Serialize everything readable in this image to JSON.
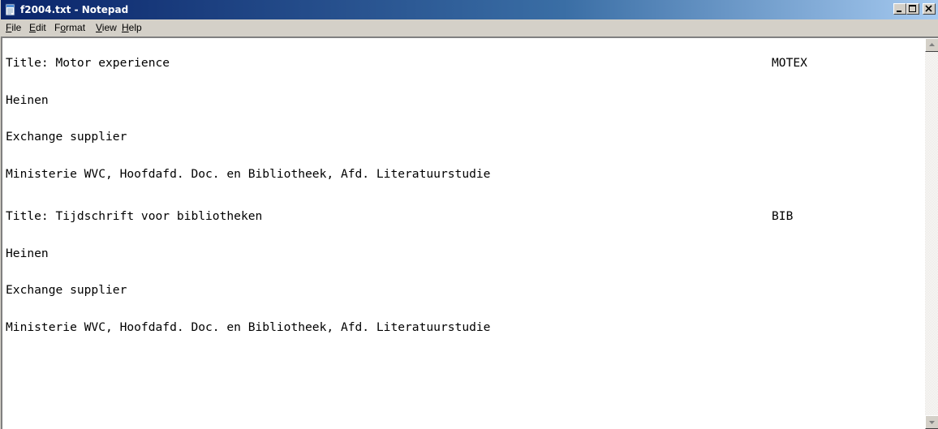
{
  "window": {
    "title": "f2004.txt - Notepad"
  },
  "menu": {
    "items": [
      {
        "label_ul": "F",
        "label_rest": "ile"
      },
      {
        "label_ul": "E",
        "label_rest": "dit"
      },
      {
        "label_pre": "F",
        "label_ul": "o",
        "label_rest": "rmat"
      },
      {
        "label_ul": "V",
        "label_rest": "iew"
      },
      {
        "label_ul": "H",
        "label_rest": "elp"
      }
    ]
  },
  "document": {
    "lines": [
      {
        "text": "Title: Motor experience",
        "code": "MOTEX"
      },
      {
        "text": "Heinen",
        "code": ""
      },
      {
        "text": "Exchange supplier",
        "code": ""
      },
      {
        "text": "Ministerie WVC, Hoofdafd. Doc. en Bibliotheek, Afd. Literatuurstudie",
        "code": ""
      },
      {
        "text": "Title: Tijdschrift voor bibliotheken",
        "code": "BIB"
      },
      {
        "text": "Heinen",
        "code": ""
      },
      {
        "text": "Exchange supplier",
        "code": ""
      },
      {
        "text": "Ministerie WVC, Hoofdafd. Doc. en Bibliotheek, Afd. Literatuurstudie",
        "code": ""
      }
    ]
  },
  "icons": {
    "app": "notepad-icon",
    "minimize": "minimize-icon",
    "maximize": "maximize-icon",
    "close": "close-icon",
    "scroll_up": "arrow-up-icon",
    "scroll_down": "arrow-down-icon"
  },
  "colors": {
    "titlebar_start": "#0a246a",
    "titlebar_end": "#a6caf0",
    "chrome": "#d4d0c8"
  }
}
